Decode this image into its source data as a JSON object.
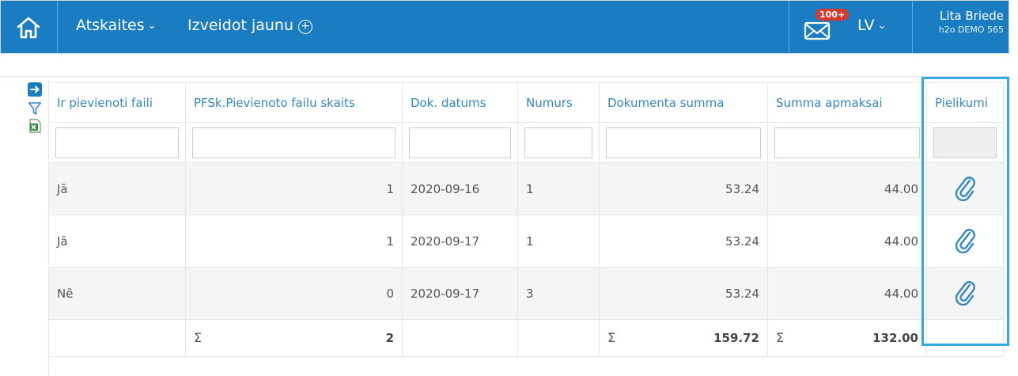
{
  "header": {
    "nav": [
      {
        "label": "Atskaites",
        "has_dropdown": true
      },
      {
        "label": "Izveidot jaunu",
        "has_plus": true
      }
    ],
    "mail_badge": "100+",
    "language": "LV",
    "user": {
      "name": "Lita Briede",
      "org": "h2o DEMO 565"
    },
    "colors": {
      "bar": "#1a7cc1",
      "badge": "#d93a2b",
      "accent": "#3787c4",
      "highlight": "#35a9df"
    }
  },
  "toolbar": {
    "icons": [
      "arrow-right-icon",
      "filter-icon",
      "excel-export-icon"
    ]
  },
  "table": {
    "columns": [
      "Ir pievienoti faili",
      "PFSk.Pievienoto failu skaits",
      "Dok. datums",
      "Numurs",
      "Dokumenta summa",
      "Summa apmaksai",
      "Pielikumi"
    ],
    "rows": [
      {
        "c0": "Jā",
        "c1": "1",
        "c2": "2020-09-16",
        "c3": "1",
        "c4": "53.24",
        "c5": "44.00"
      },
      {
        "c0": "Jā",
        "c1": "1",
        "c2": "2020-09-17",
        "c3": "1",
        "c4": "53.24",
        "c5": "44.00"
      },
      {
        "c0": "Nē",
        "c1": "0",
        "c2": "2020-09-17",
        "c3": "3",
        "c4": "53.24",
        "c5": "44.00"
      }
    ],
    "totals": {
      "sigma": "Σ",
      "c1": "2",
      "c4": "159.72",
      "c5": "132.00"
    }
  }
}
